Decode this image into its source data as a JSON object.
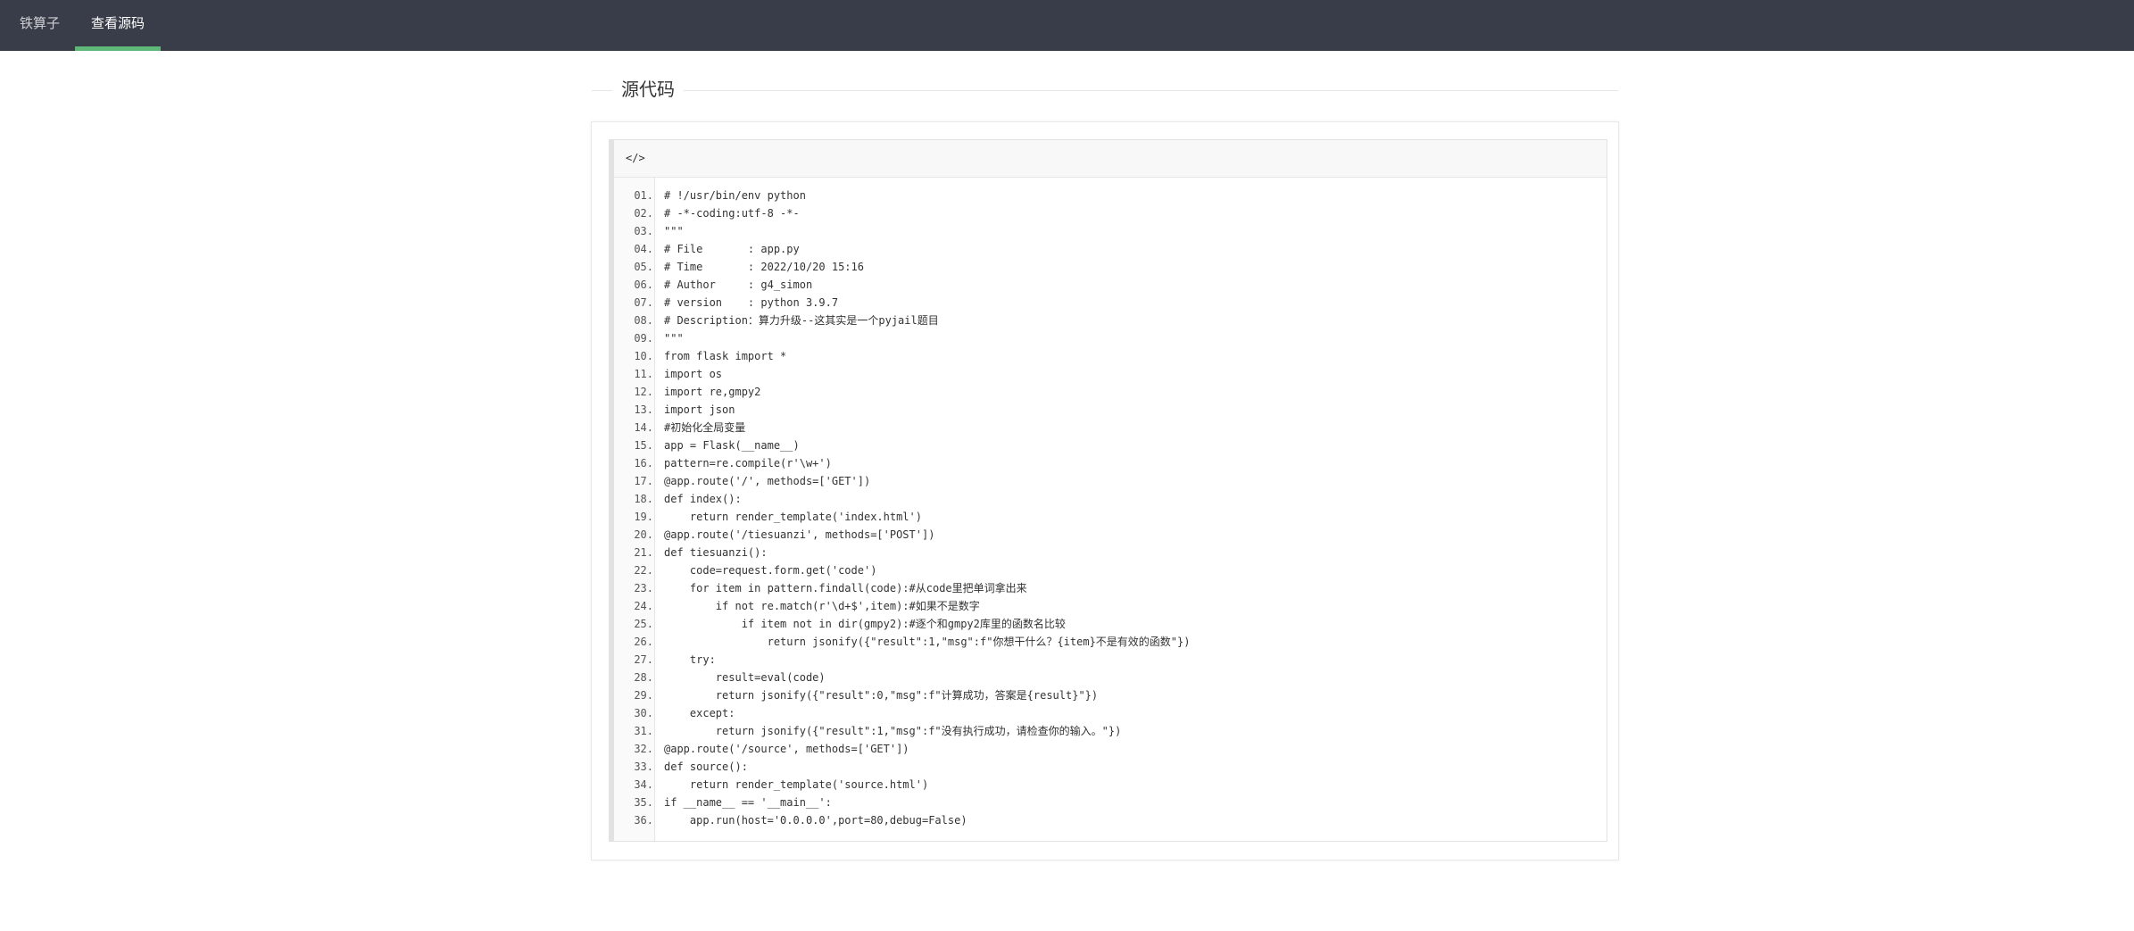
{
  "nav": {
    "items": [
      {
        "label": "铁算子"
      },
      {
        "label": "查看源码"
      }
    ],
    "active_index": 1,
    "background": "#393d49",
    "active_underline_color": "#5fb878"
  },
  "section": {
    "legend": "源代码"
  },
  "code": {
    "title": "</>",
    "lines": [
      {
        "no": "01.",
        "text": "# !/usr/bin/env python"
      },
      {
        "no": "02.",
        "text": "# -*-coding:utf-8 -*-"
      },
      {
        "no": "03.",
        "text": "\"\"\""
      },
      {
        "no": "04.",
        "text": "# File       : app.py"
      },
      {
        "no": "05.",
        "text": "# Time       : 2022/10/20 15:16"
      },
      {
        "no": "06.",
        "text": "# Author     : g4_simon"
      },
      {
        "no": "07.",
        "text": "# version    : python 3.9.7"
      },
      {
        "no": "08.",
        "text": "# Description：算力升级--这其实是一个pyjail题目"
      },
      {
        "no": "09.",
        "text": "\"\"\""
      },
      {
        "no": "10.",
        "text": "from flask import *"
      },
      {
        "no": "11.",
        "text": "import os"
      },
      {
        "no": "12.",
        "text": "import re,gmpy2"
      },
      {
        "no": "13.",
        "text": "import json"
      },
      {
        "no": "14.",
        "text": "#初始化全局变量"
      },
      {
        "no": "15.",
        "text": "app = Flask(__name__)"
      },
      {
        "no": "16.",
        "text": "pattern=re.compile(r'\\w+')"
      },
      {
        "no": "17.",
        "text": "@app.route('/', methods=['GET'])"
      },
      {
        "no": "18.",
        "text": "def index():"
      },
      {
        "no": "19.",
        "text": "    return render_template('index.html')"
      },
      {
        "no": "20.",
        "text": "@app.route('/tiesuanzi', methods=['POST'])"
      },
      {
        "no": "21.",
        "text": "def tiesuanzi():"
      },
      {
        "no": "22.",
        "text": "    code=request.form.get('code')"
      },
      {
        "no": "23.",
        "text": "    for item in pattern.findall(code):#从code里把单词拿出来"
      },
      {
        "no": "24.",
        "text": "        if not re.match(r'\\d+$',item):#如果不是数字"
      },
      {
        "no": "25.",
        "text": "            if item not in dir(gmpy2):#逐个和gmpy2库里的函数名比较"
      },
      {
        "no": "26.",
        "text": "                return jsonify({\"result\":1,\"msg\":f\"你想干什么？{item}不是有效的函数\"})"
      },
      {
        "no": "27.",
        "text": "    try:"
      },
      {
        "no": "28.",
        "text": "        result=eval(code)"
      },
      {
        "no": "29.",
        "text": "        return jsonify({\"result\":0,\"msg\":f\"计算成功，答案是{result}\"})"
      },
      {
        "no": "30.",
        "text": "    except:"
      },
      {
        "no": "31.",
        "text": "        return jsonify({\"result\":1,\"msg\":f\"没有执行成功，请检查你的输入。\"})"
      },
      {
        "no": "32.",
        "text": "@app.route('/source', methods=['GET'])"
      },
      {
        "no": "33.",
        "text": "def source():"
      },
      {
        "no": "34.",
        "text": "    return render_template('source.html')"
      },
      {
        "no": "35.",
        "text": "if __name__ == '__main__':"
      },
      {
        "no": "36.",
        "text": "    app.run(host='0.0.0.0',port=80,debug=False)"
      }
    ]
  }
}
